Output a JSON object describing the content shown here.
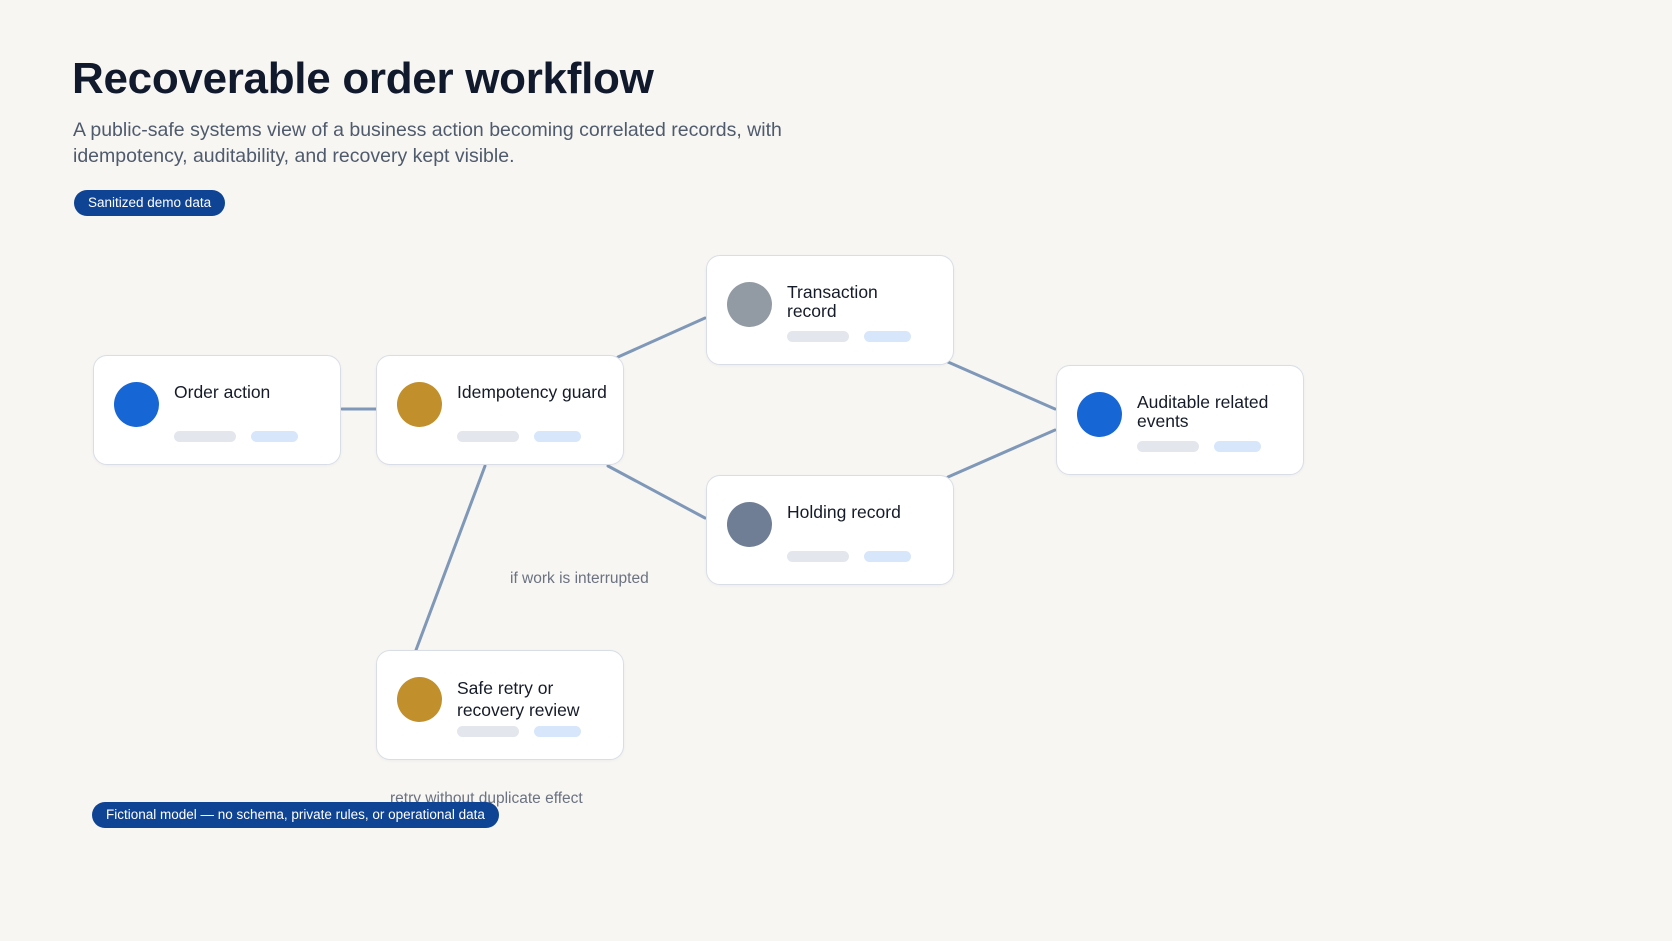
{
  "header": {
    "title": "Recoverable order workflow",
    "subtitle": "A public-safe systems view of a business action becoming correlated records, with idempotency, auditability, and recovery kept visible.",
    "badge": "Sanitized demo data"
  },
  "footer": {
    "badge": "Fictional model — no schema, private rules, or operational data"
  },
  "colors": {
    "blue": "#1766d6",
    "gold": "#c18f2b",
    "gray": "#929aa3",
    "slate": "#6f7e94",
    "edge": "#7f98b8",
    "badge": "#0f4394"
  },
  "nodes": {
    "order_action": {
      "label": "Order action",
      "color": "blue"
    },
    "idempotency_guard": {
      "label": "Idempotency guard",
      "color": "gold"
    },
    "transaction_record": {
      "label": "Transaction record",
      "color": "gray"
    },
    "holding_record": {
      "label": "Holding record",
      "color": "slate"
    },
    "auditable_events": {
      "label": "Auditable related events",
      "color": "blue"
    },
    "safe_retry": {
      "label": "Safe retry or recovery review",
      "color": "gold"
    }
  },
  "edges": [
    {
      "from": "order_action",
      "to": "idempotency_guard"
    },
    {
      "from": "idempotency_guard",
      "to": "transaction_record"
    },
    {
      "from": "idempotency_guard",
      "to": "holding_record"
    },
    {
      "from": "transaction_record",
      "to": "auditable_events"
    },
    {
      "from": "holding_record",
      "to": "auditable_events"
    },
    {
      "from": "idempotency_guard",
      "to": "safe_retry",
      "label": "if work is interrupted"
    }
  ],
  "edge_labels": {
    "interrupted": "if work is interrupted",
    "retry": "retry without duplicate effect"
  }
}
